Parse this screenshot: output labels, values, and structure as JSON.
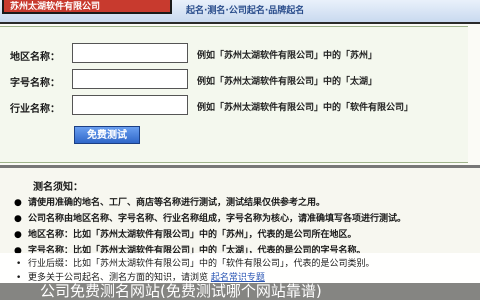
{
  "banner": {
    "logo_text": "苏州太湖软件有限公司",
    "slogan": "起名·测名·公司起名·品牌起名"
  },
  "form": {
    "rows": [
      {
        "label": "地区名称：",
        "value": "",
        "hint": "例如「苏州太湖软件有限公司」中的「苏州」"
      },
      {
        "label": "字号名称：",
        "value": "",
        "hint": "例如「苏州太湖软件有限公司」中的「太湖」"
      },
      {
        "label": "行业名称：",
        "value": "",
        "hint": "例如「苏州太湖软件有限公司」中的「软件有限公司」"
      }
    ],
    "submit_label": "免费测试"
  },
  "rules": {
    "title": "测名须知：",
    "items": [
      "请使用准确的地名、工厂、商店等名称进行测试，测试结果仅供参考之用。",
      "公司名称由地区名称、字号名称、行业名称组成，字号名称为核心，请准确填写各项进行测试。",
      "地区名称：比如「苏州太湖软件有限公司」中的「苏州」，代表的是公司所在地区。",
      "字号名称：比如「苏州太湖软件有限公司」中的「太湖」，代表的是公司的字号名称。"
    ]
  },
  "notice": {
    "lines": [
      {
        "text": "行业后缀：比如「苏州太湖软件有限公司」中的「软件有限公司」，代表的是公司类别。",
        "link": ""
      },
      {
        "text": "更多关于公司起名、测名方面的知识，请浏览",
        "link": "起名常识专题"
      }
    ]
  },
  "caption": "公司免费测名网站(免费测试哪个网站靠谱)"
}
